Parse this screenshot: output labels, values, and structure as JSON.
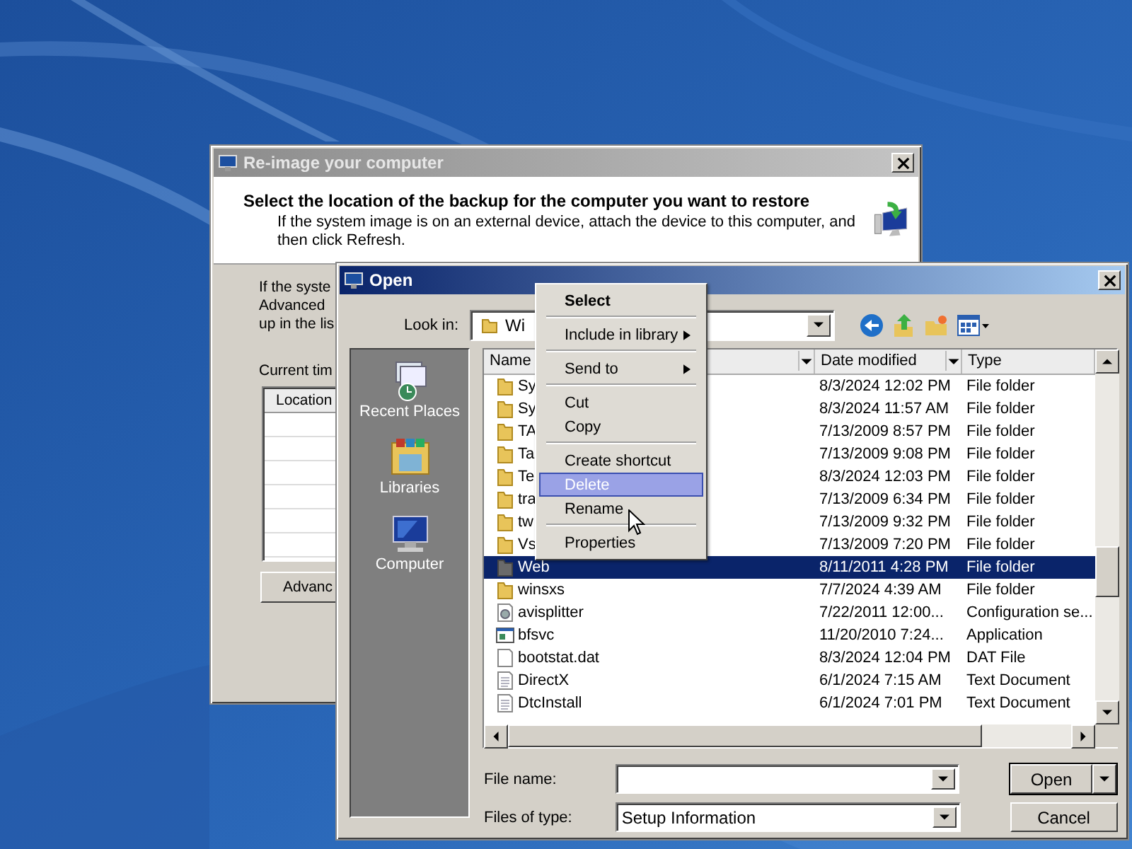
{
  "reimage_window": {
    "title": "Re-image your computer",
    "heading": "Select the location of the backup for the computer you want to restore",
    "description": "If the system image is on an external device, attach the device to this computer, and then click Refresh.",
    "body_lines": [
      "If the syste",
      "Advanced",
      "up in the lis"
    ],
    "current_label": "Current tim",
    "table_columns": [
      "Location"
    ],
    "advanced_button": "Advanc"
  },
  "open_dialog": {
    "title": "Open",
    "look_in_label": "Look in:",
    "look_in_value": "Wi",
    "places": [
      {
        "label": "Recent Places",
        "kind": "recent"
      },
      {
        "label": "Libraries",
        "kind": "libraries"
      },
      {
        "label": "Computer",
        "kind": "computer"
      }
    ],
    "columns": [
      "Name",
      "Date modified",
      "Type"
    ],
    "rows": [
      {
        "name": "Sy",
        "date": "8/3/2024 12:02 PM",
        "type": "File folder",
        "kind": "folder",
        "selected": false
      },
      {
        "name": "Sy",
        "date": "8/3/2024 11:57 AM",
        "type": "File folder",
        "kind": "folder",
        "selected": false
      },
      {
        "name": "TA",
        "date": "7/13/2009 8:57 PM",
        "type": "File folder",
        "kind": "folder",
        "selected": false
      },
      {
        "name": "Ta",
        "date": "7/13/2009 9:08 PM",
        "type": "File folder",
        "kind": "folder",
        "selected": false
      },
      {
        "name": "Te",
        "date": "8/3/2024 12:03 PM",
        "type": "File folder",
        "kind": "folder",
        "selected": false
      },
      {
        "name": "tra",
        "date": "7/13/2009 6:34 PM",
        "type": "File folder",
        "kind": "folder",
        "selected": false
      },
      {
        "name": "tw",
        "date": "7/13/2009 9:32 PM",
        "type": "File folder",
        "kind": "folder",
        "selected": false
      },
      {
        "name": "Vs",
        "date": "7/13/2009 7:20 PM",
        "type": "File folder",
        "kind": "folder",
        "selected": false
      },
      {
        "name": "Web",
        "date": "8/11/2011 4:28 PM",
        "type": "File folder",
        "kind": "folder",
        "selected": true
      },
      {
        "name": "winsxs",
        "date": "7/7/2024 4:39 AM",
        "type": "File folder",
        "kind": "folder",
        "selected": false
      },
      {
        "name": "avisplitter",
        "date": "7/22/2011 12:00...",
        "type": "Configuration se...",
        "kind": "config",
        "selected": false
      },
      {
        "name": "bfsvc",
        "date": "11/20/2010 7:24...",
        "type": "Application",
        "kind": "app",
        "selected": false
      },
      {
        "name": "bootstat.dat",
        "date": "8/3/2024 12:04 PM",
        "type": "DAT File",
        "kind": "file",
        "selected": false
      },
      {
        "name": "DirectX",
        "date": "6/1/2024 7:15 AM",
        "type": "Text Document",
        "kind": "text",
        "selected": false
      },
      {
        "name": "DtcInstall",
        "date": "6/1/2024 7:01 PM",
        "type": "Text Document",
        "kind": "text",
        "selected": false
      }
    ],
    "file_name_label": "File name:",
    "files_of_type_label": "Files of type:",
    "files_of_type_value": "Setup Information",
    "buttons": [
      {
        "label": "Open",
        "kind": "split"
      },
      {
        "label": "Cancel",
        "kind": "plain"
      }
    ]
  },
  "context_menu": {
    "items": [
      {
        "label": "Select",
        "bold": true,
        "submenu": false,
        "selected": false,
        "separator_after": true
      },
      {
        "label": "Include in library",
        "bold": false,
        "submenu": true,
        "selected": false,
        "separator_after": true
      },
      {
        "label": "Send to",
        "bold": false,
        "submenu": true,
        "selected": false,
        "separator_after": true
      },
      {
        "label": "Cut",
        "bold": false,
        "submenu": false,
        "selected": false,
        "separator_after": false
      },
      {
        "label": "Copy",
        "bold": false,
        "submenu": false,
        "selected": false,
        "separator_after": true
      },
      {
        "label": "Create shortcut",
        "bold": false,
        "submenu": false,
        "selected": false,
        "separator_after": false
      },
      {
        "label": "Delete",
        "bold": false,
        "submenu": false,
        "selected": true,
        "separator_after": false
      },
      {
        "label": "Rename",
        "bold": false,
        "submenu": false,
        "selected": false,
        "separator_after": true
      },
      {
        "label": "Properties",
        "bold": false,
        "submenu": false,
        "selected": false,
        "separator_after": false
      }
    ]
  }
}
